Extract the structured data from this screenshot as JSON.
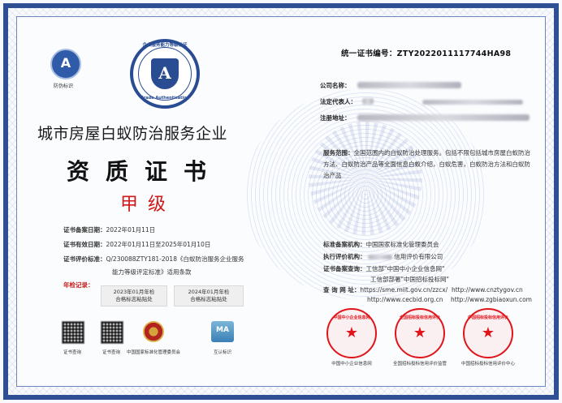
{
  "cert_no_label": "统一证书编号：",
  "cert_no": "ZTY2022011117744HA98",
  "logo": {
    "glyph": "A",
    "label": "防伪标识"
  },
  "badge": {
    "glyph": "A",
    "top_text": "企业服务能力等级认证",
    "bottom_text": "Grade Authentication"
  },
  "info": {
    "company_label": "公司名称：",
    "legal_label": "法定代表人：",
    "address_label": "注册地址："
  },
  "company_title": "城市房屋白蚁防治服务企业",
  "doc_title": "资质证书",
  "grade": "甲级",
  "service": {
    "label": "服务范围：",
    "text": "全国范围内的白蚁防治处理服务。包括不限包括城市房屋白蚁防治方法、白蚁防治产品等全面信息白蚁介绍，白蚁危害，白蚁防治方法和白蚁防治产品"
  },
  "dates": {
    "record_label": "证书备案日期：",
    "record_value": "2022年01月11日",
    "valid_label": "证书有效日期：",
    "valid_value": "2022年01月11日至2025年01月10日",
    "standard_label": "证书评价标准：",
    "standard_value_1": "Q/230088ZTY181-2018《白蚁防治服务企业服务",
    "standard_value_2": "能力等级评定标准》适用条款"
  },
  "annual": {
    "label": "年检记录：",
    "sticker1_line1": "2023年01月年检",
    "sticker1_line2": "合格标志粘贴处",
    "sticker2_line1": "2024年01月年检",
    "sticker2_line2": "合格标志粘贴处"
  },
  "bottom_icons": {
    "qr1": "证书查询",
    "qr2": "证书查询",
    "emblem": "中国国家标准化管理委员会",
    "mutual": "互认标识",
    "mutual_glyph": "MA"
  },
  "registry": {
    "org_label": "标准备案机构：",
    "org_value": "中国国家标准化管理委员会",
    "exec_label": "执行评价机构：",
    "exec_value": "信用评价有限公司",
    "query_label": "证书备案查询：",
    "query_value_1": "工信部\"中国中小企业信息网\"",
    "query_value_2": "工信部部署\"中国招标投标网\"",
    "site_label": "查 询 网 址：",
    "site_1": "https://sme.miit.gov.cn/zzcx/",
    "site_2": "http://www.cnztygov.cn",
    "site_3": "http://www.cecbid.org.cn",
    "site_4": "http://www.zgbiaoxun.com"
  },
  "seals": [
    {
      "arc": "中国中小企业信息网",
      "label": "中国中小企业信息网"
    },
    {
      "arc": "全国招标投标信用评价",
      "label": "全国招标投标信用评价监管"
    },
    {
      "arc": "中国招标投标信用评价",
      "label": "中国招标投标信用评价中心"
    }
  ]
}
